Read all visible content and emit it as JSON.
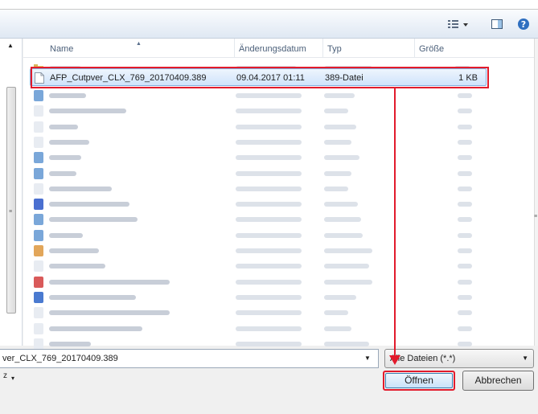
{
  "toolbar": {
    "view_icon": "view-options-icon",
    "pane_icon": "preview-pane-icon",
    "help_icon": "help-icon"
  },
  "columns": {
    "name": "Name",
    "date": "Änderungsdatum",
    "type": "Typ",
    "size": "Größe"
  },
  "selected_file": {
    "name": "AFP_Cutpver_CLX_769_20170409.389",
    "date": "09.04.2017 01:11",
    "type": "389-Datei",
    "size": "1 KB"
  },
  "left_pane": {
    "visible_text": "z"
  },
  "filename": {
    "value": "ver_CLX_769_20170409.389"
  },
  "filetype": {
    "value": "Alle Dateien (*.*)"
  },
  "buttons": {
    "open": "Öffnen",
    "cancel": "Abbrechen"
  },
  "colors": {
    "annotation_red": "#e21b2c",
    "selection_blue": "#cfe3fb"
  }
}
